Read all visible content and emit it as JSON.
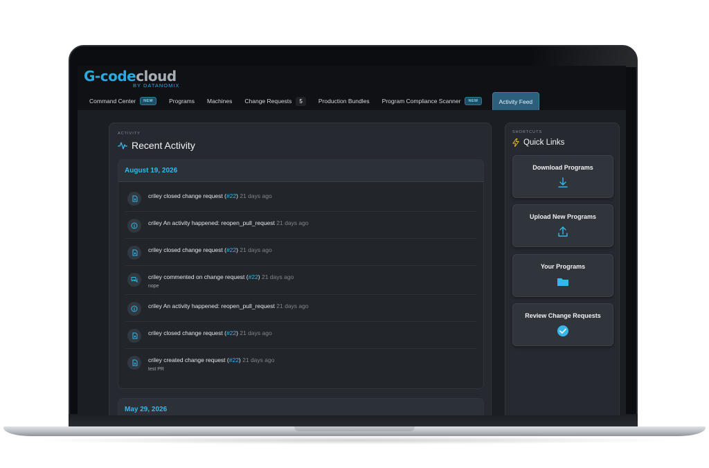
{
  "app": {
    "logo_main": "G-code",
    "logo_cloud": "cloud",
    "logo_sub": "BY DATANOMIX"
  },
  "tabs": [
    {
      "label": "Command Center",
      "badge": "NEW"
    },
    {
      "label": "Programs"
    },
    {
      "label": "Machines"
    },
    {
      "label": "Change Requests",
      "count": "5"
    },
    {
      "label": "Production Bundles"
    },
    {
      "label": "Program Compliance Scanner",
      "badge": "NEW"
    },
    {
      "label": "Activity Feed",
      "active": true
    }
  ],
  "activity": {
    "eyebrow": "ACTIVITY",
    "title": "Recent Activity",
    "days": [
      {
        "date": "August 19, 2026",
        "items": [
          {
            "icon": "pull-request-closed-icon",
            "user": "criley",
            "action": "closed change request (",
            "ref": "#22",
            "after": ")",
            "time": "21 days ago",
            "note": ""
          },
          {
            "icon": "info-circle-icon",
            "user": "criley",
            "action": "An activity happened: reopen_pull_request",
            "ref": "",
            "after": "",
            "time": "21 days ago",
            "note": ""
          },
          {
            "icon": "pull-request-closed-icon",
            "user": "criley",
            "action": "closed change request (",
            "ref": "#22",
            "after": ")",
            "time": "21 days ago",
            "note": ""
          },
          {
            "icon": "comment-icon",
            "user": "criley",
            "action": "commented on change request (",
            "ref": "#22",
            "after": ")",
            "time": "21 days ago",
            "note": "nope"
          },
          {
            "icon": "info-circle-icon",
            "user": "criley",
            "action": "An activity happened: reopen_pull_request",
            "ref": "",
            "after": "",
            "time": "21 days ago",
            "note": ""
          },
          {
            "icon": "pull-request-closed-icon",
            "user": "criley",
            "action": "closed change request (",
            "ref": "#22",
            "after": ")",
            "time": "21 days ago",
            "note": ""
          },
          {
            "icon": "pull-request-created-icon",
            "user": "criley",
            "action": "created change request (",
            "ref": "#22",
            "after": ")",
            "time": "21 days ago",
            "note": "test PR"
          }
        ]
      },
      {
        "date": "May 29, 2026",
        "items": []
      }
    ]
  },
  "shortcuts": {
    "eyebrow": "SHORTCUTS",
    "title": "Quick Links",
    "links": [
      {
        "label": "Download Programs",
        "icon": "download-icon"
      },
      {
        "label": "Upload New Programs",
        "icon": "upload-icon"
      },
      {
        "label": "Your Programs",
        "icon": "folder-icon"
      },
      {
        "label": "Review Change Requests",
        "icon": "check-circle-icon"
      }
    ]
  },
  "colors": {
    "accent": "#38b6ea",
    "background": "#1b1e23",
    "panel": "#262a30",
    "bolt": "#e8b62c"
  }
}
